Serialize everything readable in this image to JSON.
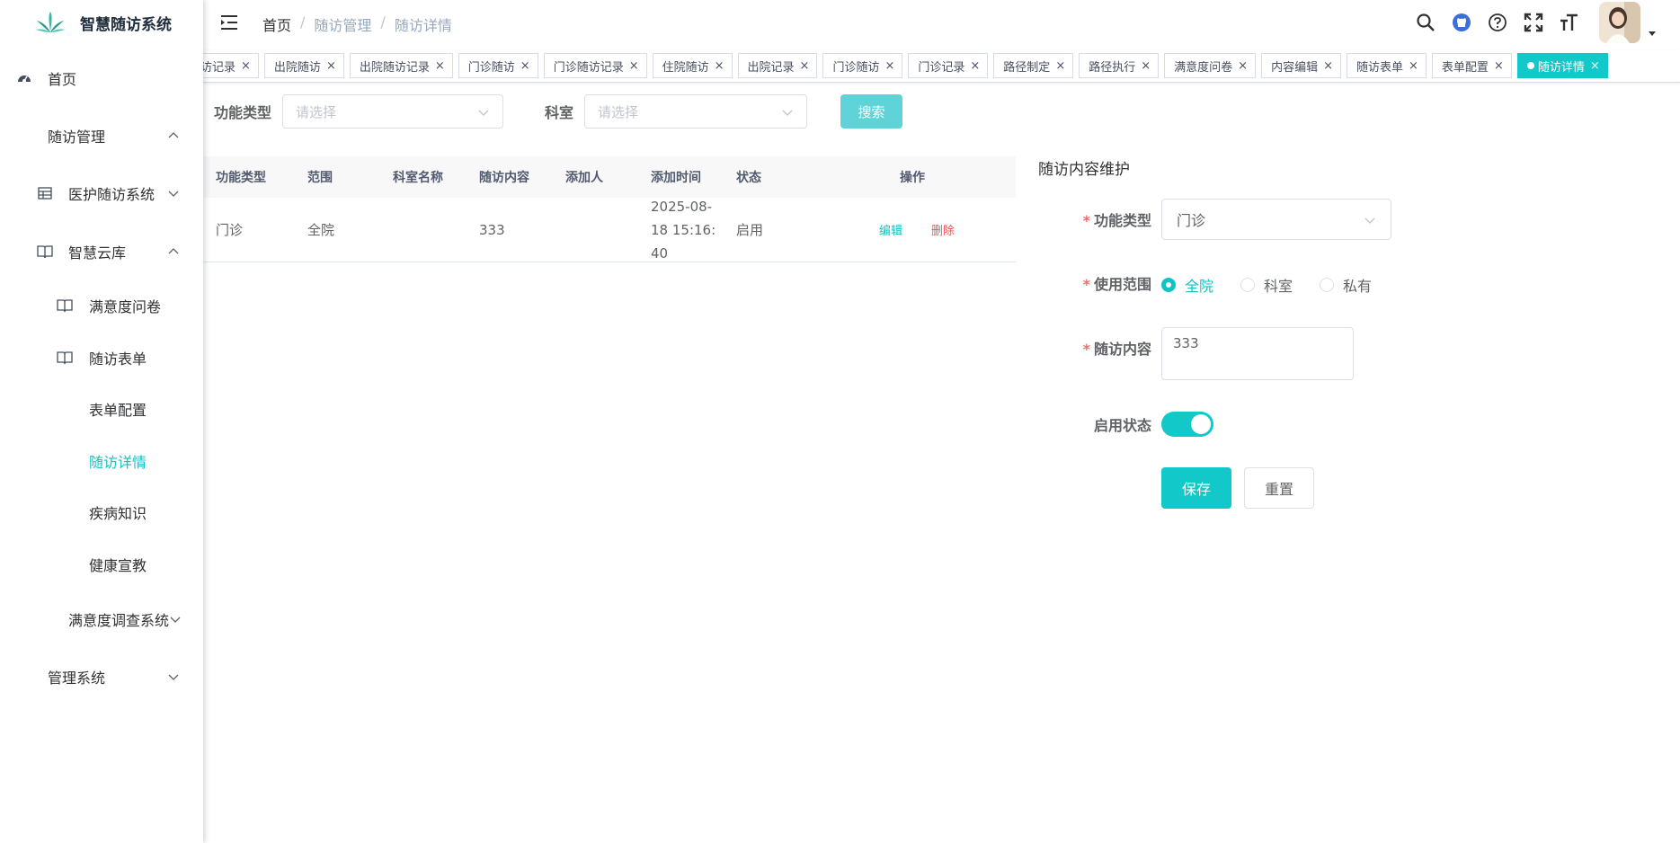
{
  "app": {
    "title": "智慧随访系统"
  },
  "sidebar": {
    "items": [
      {
        "label": "首页"
      },
      {
        "label": "随访管理"
      },
      {
        "label": "医护随访系统"
      },
      {
        "label": "智慧云库"
      },
      {
        "label": "满意度问卷"
      },
      {
        "label": "随访表单"
      },
      {
        "label": "表单配置"
      },
      {
        "label": "随访详情"
      },
      {
        "label": "疾病知识"
      },
      {
        "label": "健康宣教"
      },
      {
        "label": "满意度调查系统"
      },
      {
        "label": "管理系统"
      }
    ]
  },
  "breadcrumb": {
    "root": "首页",
    "sep": "/",
    "level1": "随访管理",
    "level2": "随访详情"
  },
  "tags": [
    {
      "label": "访记录"
    },
    {
      "label": "出院随访"
    },
    {
      "label": "出院随访记录"
    },
    {
      "label": "门诊随访"
    },
    {
      "label": "门诊随访记录"
    },
    {
      "label": "住院随访"
    },
    {
      "label": "出院记录"
    },
    {
      "label": "门诊随访"
    },
    {
      "label": "门诊记录"
    },
    {
      "label": "路径制定"
    },
    {
      "label": "路径执行"
    },
    {
      "label": "满意度问卷"
    },
    {
      "label": "内容编辑"
    },
    {
      "label": "随访表单"
    },
    {
      "label": "表单配置"
    },
    {
      "label": "随访详情"
    }
  ],
  "search": {
    "type_label": "功能类型",
    "type_placeholder": "请选择",
    "dept_label": "科室",
    "dept_placeholder": "请选择",
    "button": "搜索"
  },
  "table": {
    "headers": [
      "功能类型",
      "范围",
      "科室名称",
      "随访内容",
      "添加人",
      "添加时间",
      "状态",
      "操作"
    ],
    "rows": [
      {
        "type": "门诊",
        "scope": "全院",
        "dept": "",
        "content": "333",
        "adder": "",
        "time_l1": "2025-08-",
        "time_l2": "18 15:16:",
        "time_l3": "40",
        "status": "启用",
        "edit": "编辑",
        "delete": "删除"
      }
    ]
  },
  "form": {
    "title": "随访内容维护",
    "required_mark": "*",
    "type_label": "功能类型",
    "type_value": "门诊",
    "scope_label": "使用范围",
    "scope_options": [
      "全院",
      "科室",
      "私有"
    ],
    "content_label": "随访内容",
    "content_value": "333",
    "status_label": "启用状态",
    "save": "保存",
    "reset": "重置"
  },
  "colors": {
    "accent": "#13c8c9",
    "danger": "#ff4d4f"
  }
}
